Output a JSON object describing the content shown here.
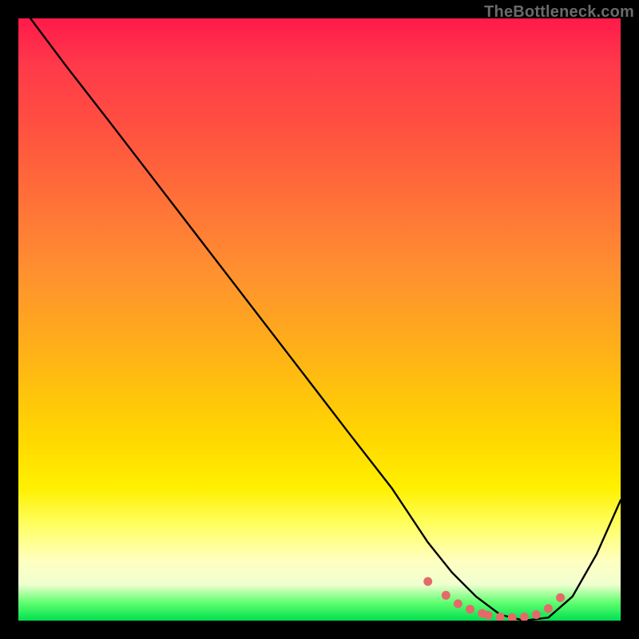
{
  "watermark": {
    "text": "TheBottleneck.com"
  },
  "chart_data": {
    "type": "line",
    "title": "",
    "xlabel": "",
    "ylabel": "",
    "xlim": [
      0,
      100
    ],
    "ylim": [
      0,
      100
    ],
    "series": [
      {
        "name": "curve",
        "x": [
          2,
          8,
          15,
          25,
          35,
          45,
          55,
          62,
          68,
          72,
          76,
          80,
          84,
          88,
          92,
          96,
          100
        ],
        "y": [
          100,
          92,
          83,
          70,
          57,
          44,
          31,
          22,
          13,
          8,
          4,
          1,
          0,
          0.5,
          4,
          11,
          20
        ]
      }
    ],
    "markers": {
      "name": "bottom-dots",
      "x": [
        68,
        71,
        73,
        75,
        77,
        78,
        80,
        82,
        84,
        86,
        88,
        90
      ],
      "y": [
        6.5,
        4.2,
        2.8,
        1.9,
        1.2,
        0.9,
        0.6,
        0.5,
        0.6,
        1.0,
        2.0,
        3.8
      ]
    },
    "colors": {
      "curve": "#000000",
      "marker": "#e46a6a"
    }
  }
}
